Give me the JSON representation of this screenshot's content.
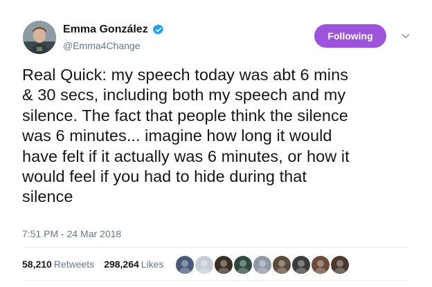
{
  "author": {
    "name": "Emma González",
    "handle": "@Emma4Change",
    "verified_color": "#1da1f2"
  },
  "follow_button": {
    "label": "Following",
    "color": "#9e53dc"
  },
  "tweet": {
    "text": "Real Quick: my speech today was abt 6 mins\n& 30 secs, including both my speech and my\nsilence. The fact that people think the silence\nwas 6 minutes... imagine how long it would\nhave felt if it actually was 6 minutes, or how it\nwould feel if you had to hide during that\nsilence",
    "timestamp": "7:51 PM - 24 Mar 2018"
  },
  "stats": {
    "retweets_count": "58,210",
    "retweets_label": "Retweets",
    "likes_count": "298,264",
    "likes_label": "Likes"
  },
  "likers": {
    "colors": [
      "#4a5a78",
      "#c5ccd3",
      "#3a2e22",
      "#2d4a3e",
      "#8d99a6",
      "#5a4a3a",
      "#3b3b3b",
      "#6b4a3a",
      "#4a3a2e"
    ]
  }
}
